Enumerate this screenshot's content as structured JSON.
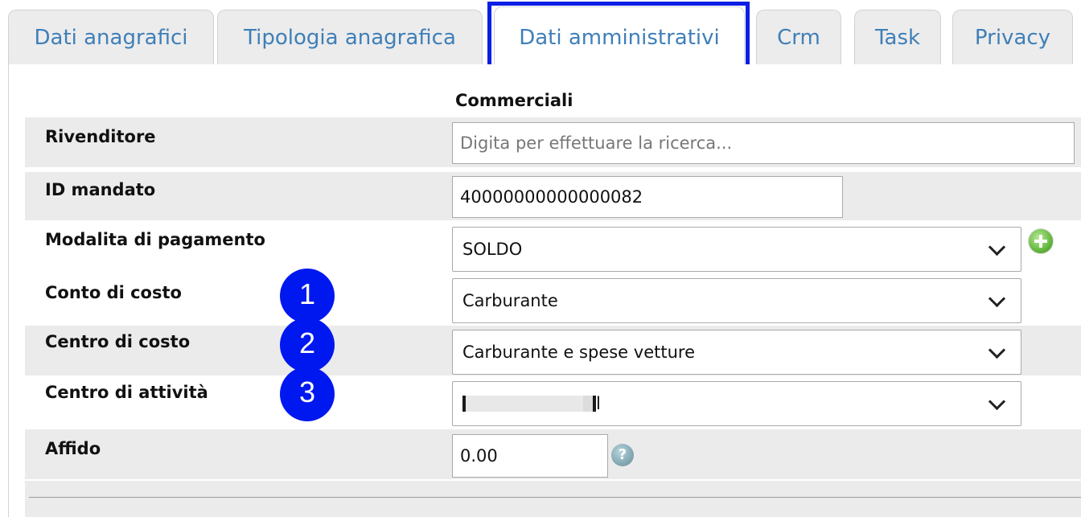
{
  "tabs": [
    {
      "label": "Dati anagrafici",
      "active": false
    },
    {
      "label": "Tipologia anagrafica",
      "active": false
    },
    {
      "label": "Dati amministrativi",
      "active": true
    },
    {
      "label": "Crm",
      "active": false
    },
    {
      "label": "Task",
      "active": false
    },
    {
      "label": "Privacy",
      "active": false
    }
  ],
  "section_title": "Commerciali",
  "fields": {
    "rivenditore": {
      "label": "Rivenditore",
      "placeholder": "Digita per effettuare la ricerca..."
    },
    "id_mandato": {
      "label": "ID mandato",
      "value": "40000000000000082"
    },
    "modalita_pagamento": {
      "label": "Modalita di pagamento",
      "value": "SOLDO"
    },
    "conto_costo": {
      "label": "Conto di costo",
      "value": "Carburante"
    },
    "centro_costo": {
      "label": "Centro di costo",
      "value": "Carburante e spese vetture"
    },
    "centro_attivita": {
      "label": "Centro di attività",
      "value": "l"
    },
    "affido": {
      "label": "Affido",
      "value": "0.00"
    }
  },
  "badges": [
    "1",
    "2",
    "3"
  ],
  "colors": {
    "tab_text": "#3f7fb8",
    "highlight": "#0a1ee6",
    "badge": "#0018f0",
    "row_shade": "#ebebeb"
  }
}
